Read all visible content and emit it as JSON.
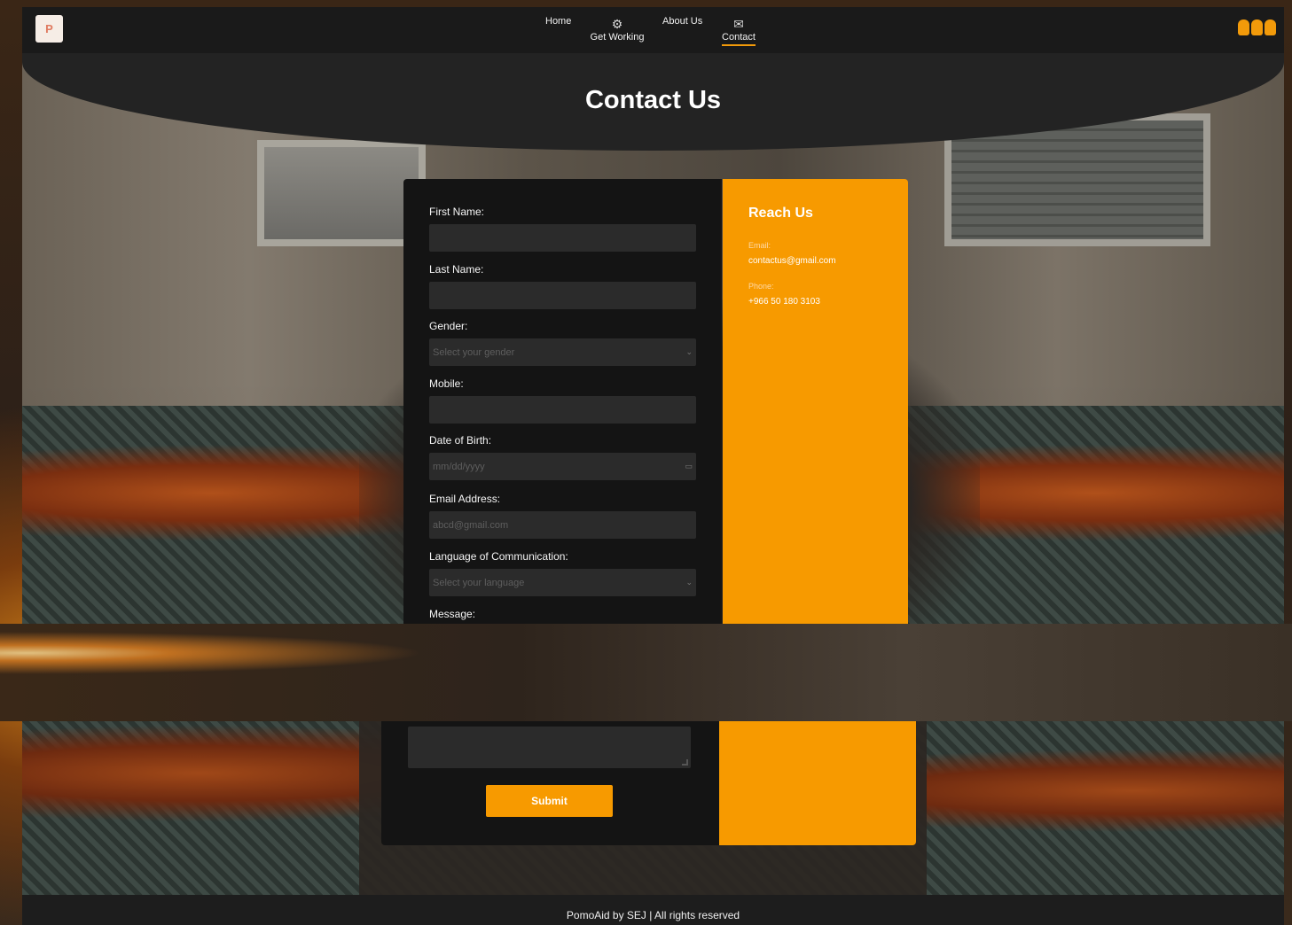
{
  "nav": {
    "logo_text": "P",
    "items": [
      {
        "label": "Home",
        "icon": ""
      },
      {
        "label": "Get Working",
        "icon": "gear-icon"
      },
      {
        "label": "About Us",
        "icon": ""
      },
      {
        "label": "Contact",
        "icon": "envelope-icon"
      }
    ],
    "active": "Contact",
    "accent": "#f29a0a"
  },
  "header": {
    "title": "Contact Us"
  },
  "form": {
    "first_name_label": "First Name:",
    "last_name_label": "Last Name:",
    "gender_label": "Gender:",
    "gender_placeholder": "Select your gender",
    "mobile_label": "Mobile:",
    "dob_label": "Date of Birth:",
    "dob_placeholder": "mm/dd/yyyy",
    "email_label": "Email Address:",
    "email_placeholder": "abcd@gmail.com",
    "language_label": "Language of Communication:",
    "language_placeholder": "Select your language",
    "message_label": "Message:",
    "submit_label": "Submit"
  },
  "reach": {
    "title": "Reach Us",
    "email_label": "Email:",
    "email_value": "contactus@gmail.com",
    "phone_label": "Phone:",
    "phone_value": "+966 50 180 3103",
    "color": "#f79a00"
  },
  "footer": {
    "text": "PomoAid by SEJ | All rights reserved"
  }
}
